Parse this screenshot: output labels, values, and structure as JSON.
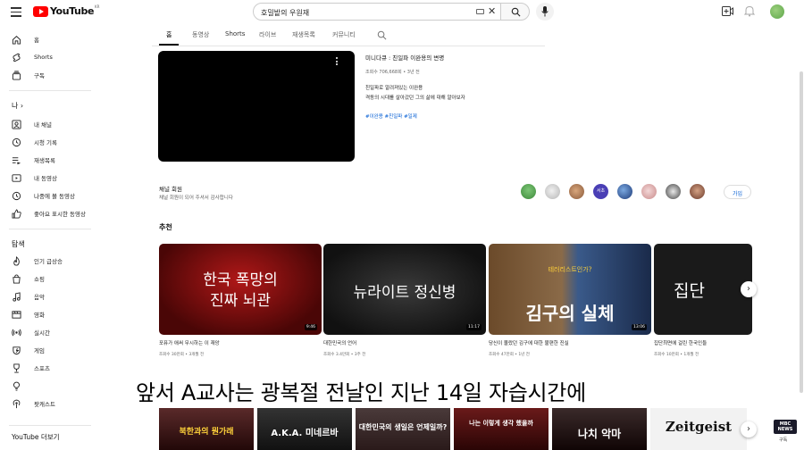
{
  "header": {
    "logo_text": "YouTube",
    "logo_region": "KR",
    "search_value": "호밀밭의 우원재"
  },
  "sidebar": {
    "main_items": [
      {
        "label": "홈",
        "icon": "home-icon"
      },
      {
        "label": "Shorts",
        "icon": "shorts-icon"
      },
      {
        "label": "구독",
        "icon": "subscriptions-icon"
      }
    ],
    "you_heading": "나",
    "you_items": [
      {
        "label": "내 채널",
        "icon": "channel-icon"
      },
      {
        "label": "시청 기록",
        "icon": "history-icon"
      },
      {
        "label": "재생목록",
        "icon": "playlist-icon"
      },
      {
        "label": "내 동영상",
        "icon": "my-videos-icon"
      },
      {
        "label": "나중에 볼 동영상",
        "icon": "watch-later-icon"
      },
      {
        "label": "좋아요 표시한 동영상",
        "icon": "like-icon"
      }
    ],
    "explore_heading": "탐색",
    "explore_items": [
      {
        "label": "인기 급상승",
        "icon": "trending-icon"
      },
      {
        "label": "쇼핑",
        "icon": "shopping-icon"
      },
      {
        "label": "음악",
        "icon": "music-icon"
      },
      {
        "label": "영화",
        "icon": "movie-icon"
      },
      {
        "label": "실시간",
        "icon": "live-icon"
      },
      {
        "label": "게임",
        "icon": "gaming-icon"
      },
      {
        "label": "스포츠",
        "icon": "sports-icon"
      },
      {
        "label": "",
        "icon": "learning-icon"
      },
      {
        "label": "팟캐스트",
        "icon": "podcast-icon"
      }
    ],
    "more_heading": "YouTube 더보기"
  },
  "tabs": [
    "홈",
    "동영상",
    "Shorts",
    "라이브",
    "재생목록",
    "커뮤니티"
  ],
  "featured": {
    "title": "미니다큐 : 친일파 이완용의 변명",
    "meta": "조회수 706,668회 • 3년 전",
    "desc_line1": "친일파로 알려져있는 이완용",
    "desc_line2": "격동의 시대를 살아갔던 그의 삶에 대해 알아보자",
    "tags": "#이완용 #친일파 #일제"
  },
  "members": {
    "title": "채널 회원",
    "subtitle": "채널 회원이 되어 주셔서 감사합니다",
    "avatar_label": "서초",
    "join_label": "가입"
  },
  "recommended": {
    "heading": "추천",
    "cards": [
      {
        "thumb_line1": "한국 폭망의",
        "thumb_line2": "진짜 뇌관",
        "duration": "9:46",
        "title": "포퓨가 애써 무시하는 이 재앙",
        "meta": "조회수 30만회 • 3개월 전"
      },
      {
        "thumb_line1": "뉴라이트 정신병",
        "thumb_line2": "",
        "duration": "11:17",
        "title": "대한민국의 언어",
        "meta": "조회수 3.4만회 • 3주 전"
      },
      {
        "thumb_line1": "김구의 실체",
        "thumb_line2": "테러리스트인가?",
        "duration": "13:06",
        "title": "당신이 몰랐던 김구에 대한 불편한 진실",
        "meta": "조회수 47만회 • 1년 전"
      },
      {
        "thumb_line1": "집단",
        "thumb_line2": "",
        "duration": "",
        "title": "집단최면에 걸린 한국인들",
        "meta": "조회수 10만회 • 1개월 전"
      }
    ]
  },
  "caption": "앞서 A교사는 광복절 전날인 지난 14일 자습시간에",
  "bottom_row": [
    {
      "text": "북한과의 뭔가래"
    },
    {
      "text": "A.K.A. 미네르바"
    },
    {
      "text": "대한민국의 생일은 언제일까?"
    },
    {
      "text": "나는 이렇게 생각 했을까"
    },
    {
      "text": "나치 악마"
    },
    {
      "text": "Zeitgeist"
    }
  ],
  "watermark": {
    "badge": "MBC NEWS",
    "sub": "구독"
  },
  "colors": {
    "brand_red": "#ff0000",
    "link_blue": "#065fd4"
  }
}
